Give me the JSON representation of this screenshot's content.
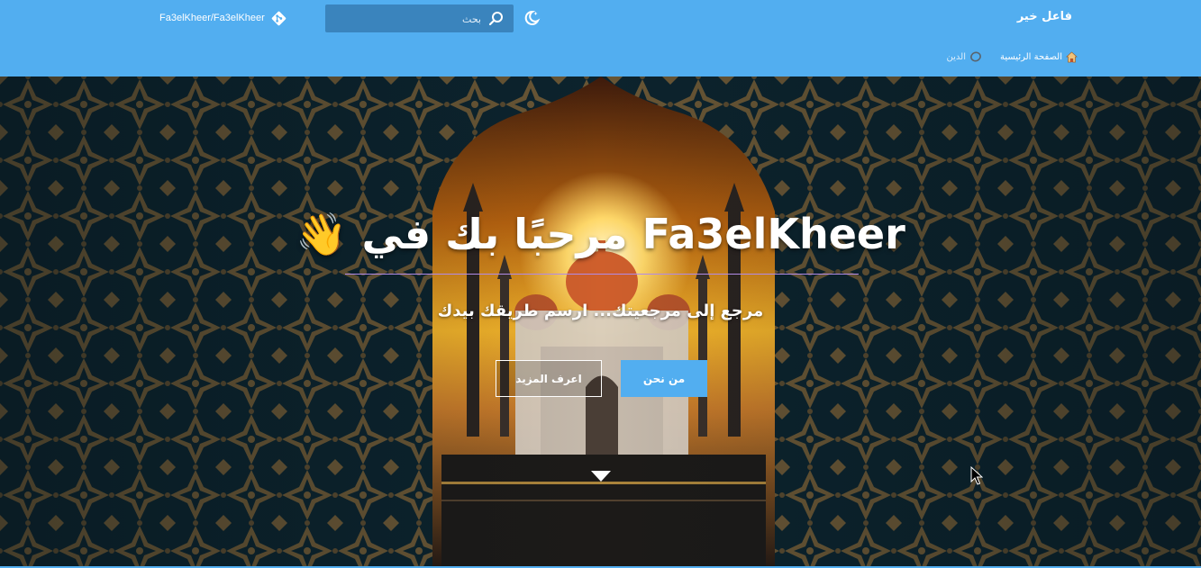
{
  "header": {
    "site_title": "فاعل خير",
    "search_placeholder": "بحث",
    "repo_label": "Fa3elKheer/Fa3elKheer",
    "nav": [
      {
        "label": "الصفحة الرئيسية",
        "icon": "home-icon"
      },
      {
        "label": "الدين",
        "icon": "circle-icon"
      }
    ]
  },
  "hero": {
    "title": "👋 مرحبًا بك في Fa3elKheer",
    "subtitle": "مرجع إلى مرجعيتك... ارسم طريقك بيدك",
    "primary_button": "من نحن",
    "secondary_button": "اعرف المزيد"
  },
  "colors": {
    "accent": "#52aef0",
    "search_bg": "#3a84bd",
    "rule": "#b18be8"
  }
}
